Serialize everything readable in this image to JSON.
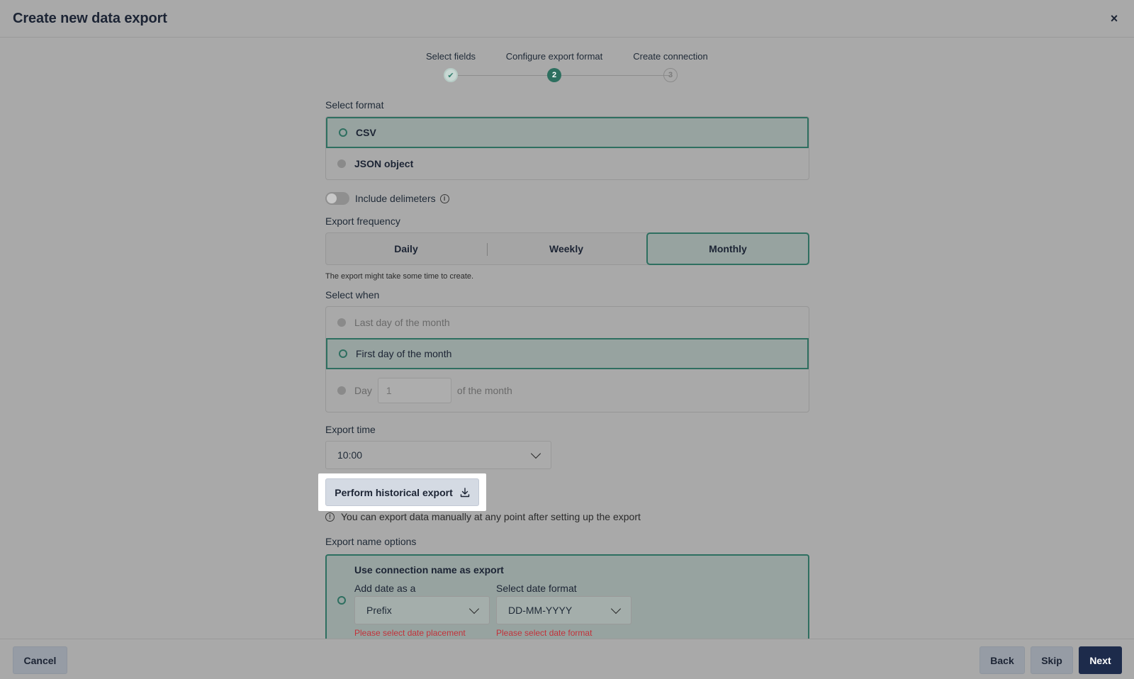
{
  "header": {
    "title": "Create new data export",
    "close_symbol": "×"
  },
  "stepper": {
    "steps": [
      {
        "label": "Select fields",
        "state": "done",
        "marker": "✔"
      },
      {
        "label": "Configure export format",
        "state": "active",
        "marker": "2"
      },
      {
        "label": "Create connection",
        "state": "todo",
        "marker": "3"
      }
    ]
  },
  "format": {
    "label": "Select format",
    "options": [
      {
        "label": "CSV",
        "selected": true
      },
      {
        "label": "JSON object",
        "selected": false
      }
    ],
    "delimiters_label": "Include delimeters",
    "delimiters_on": false
  },
  "frequency": {
    "label": "Export frequency",
    "options": [
      "Daily",
      "Weekly",
      "Monthly"
    ],
    "selected": "Monthly",
    "hint": "The export might take some time to create."
  },
  "when": {
    "label": "Select when",
    "last_day": "Last day of the month",
    "first_day": "First day of the month",
    "day_prefix": "Day",
    "day_value": "1",
    "day_suffix": "of the month"
  },
  "time": {
    "label": "Export time",
    "value": "10:00"
  },
  "historical": {
    "button_label": "Perform historical export",
    "note": "You can export data manually at any point after setting up the export"
  },
  "name_options": {
    "label": "Export name options",
    "option_title": "Use connection name as export",
    "date_as_label": "Add date as a",
    "date_as_value": "Prefix",
    "date_as_error": "Please select date placement",
    "date_format_label": "Select date format",
    "date_format_value": "DD-MM-YYYY",
    "date_format_error": "Please select date format"
  },
  "footer": {
    "cancel": "Cancel",
    "back": "Back",
    "skip": "Skip",
    "next": "Next"
  },
  "colors": {
    "accent": "#2e6f60",
    "primary": "#1d2b4b",
    "error": "#c2323a"
  },
  "icons": [
    "close-icon",
    "check-icon",
    "info-icon",
    "chevron-down-icon",
    "download-icon"
  ]
}
